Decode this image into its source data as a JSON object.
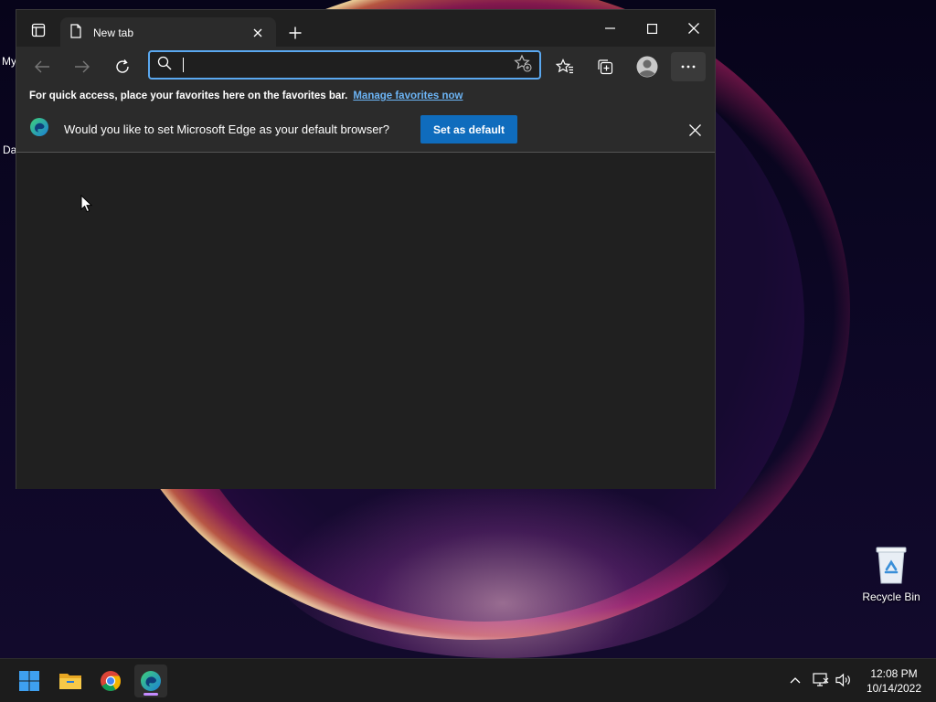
{
  "desktop": {
    "recycle_bin_label": "Recycle Bin",
    "partial_label_1": "My",
    "partial_label_2": "Da"
  },
  "browser": {
    "tab": {
      "title": "New tab"
    },
    "address": {
      "value": "",
      "placeholder": ""
    },
    "favorites_bar": {
      "message": "For quick access, place your favorites here on the favorites bar.",
      "link": "Manage favorites now"
    },
    "infobar": {
      "message": "Would you like to set Microsoft Edge as your default browser?",
      "button": "Set as default"
    }
  },
  "taskbar": {
    "time": "12:08 PM",
    "date": "10/14/2022"
  },
  "colors": {
    "accent": "#0f6cbd",
    "link": "#6cb4f5",
    "address_focus": "#5aa8f0",
    "browser_bg": "#202020",
    "toolbar_bg": "#2b2b2b",
    "taskbar_bg": "#1c1c1c"
  },
  "icons": {
    "tab_actions": "tab-actions-icon",
    "page": "page-icon",
    "back": "back-arrow-icon",
    "forward": "forward-arrow-icon",
    "refresh": "refresh-icon",
    "search": "search-icon",
    "add_favorite": "add-favorite-icon",
    "favorites": "favorites-icon",
    "collections": "collections-icon",
    "profile": "profile-icon",
    "more": "more-icon",
    "edge": "edge-logo-icon",
    "start": "windows-start-icon",
    "file_explorer": "file-explorer-icon",
    "chrome": "chrome-icon",
    "chevron_up": "chevron-up-icon",
    "network": "network-icon",
    "volume": "volume-icon"
  }
}
